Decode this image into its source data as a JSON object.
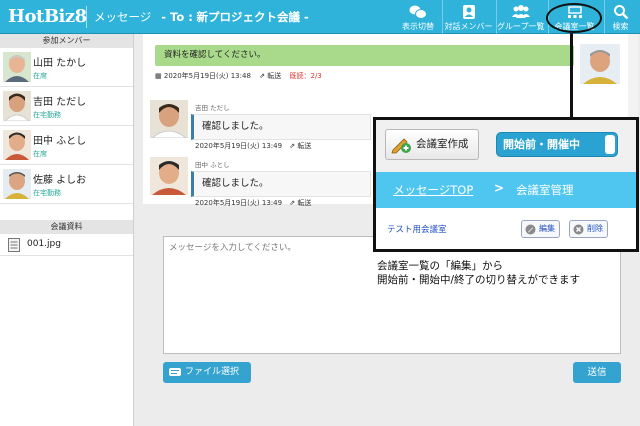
{
  "header": {
    "logo": "HotBiz8",
    "section": "メッセージ",
    "to_label": "- To :",
    "room": "新プロジェクト会議 -",
    "buttons": [
      {
        "label": "表示切替",
        "icon": "display-switch-icon"
      },
      {
        "label": "対話メンバー",
        "icon": "member-icon"
      },
      {
        "label": "グループ一覧",
        "icon": "group-icon"
      },
      {
        "label": "会議室一覧",
        "icon": "meeting-room-icon"
      },
      {
        "label": "検索",
        "icon": "search-icon"
      }
    ]
  },
  "sidebar": {
    "members_title": "参加メンバー",
    "members": [
      {
        "name": "山田 たかし",
        "status": "在席"
      },
      {
        "name": "吉田 ただし",
        "status": "在宅勤務"
      },
      {
        "name": "田中 ふとし",
        "status": "在席"
      },
      {
        "name": "佐藤 よしお",
        "status": "在宅勤務"
      }
    ],
    "docs_title": "会議資料",
    "docs": [
      {
        "name": "001.jpg"
      }
    ]
  },
  "messages": {
    "mine": {
      "text": "資料を確認してください。",
      "meta": "2020年5月19日(火) 13:48",
      "forward": "転送",
      "read": "既読：2/3"
    },
    "others": [
      {
        "name": "吉田 ただし",
        "text": "確認しました。",
        "meta": "2020年5月19日(火) 13:49",
        "forward": "転送"
      },
      {
        "name": "田中 ふとし",
        "text": "確認しました。",
        "meta": "2020年5月19日(火) 13:49",
        "forward": "転送"
      }
    ]
  },
  "composer": {
    "placeholder": "メッセージを入力してください。",
    "file_button": "ファイル選択",
    "send_button": "送信"
  },
  "callout": {
    "create_button": "会議室作成",
    "toggle_label": "開始前・開催中",
    "nav_link": "メッセージTOP",
    "nav_arrow": ">",
    "nav_current": "会議室管理",
    "room_name": "テスト用会議室",
    "edit_button": "編集",
    "delete_button": "削除",
    "note_line1": "会議室一覧の「編集」から",
    "note_line2": "開始前・開始中/終了の切り替えができます"
  },
  "colors": {
    "header": "#2fb3da",
    "accent": "#35a3cf",
    "my_bubble": "#a9d98b",
    "read_red": "#e2302a",
    "status_green": "#2aa89c"
  }
}
